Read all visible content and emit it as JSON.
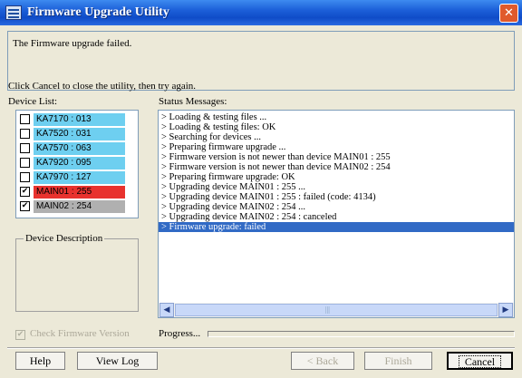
{
  "window": {
    "title": "Firmware Upgrade Utility",
    "close_glyph": "✕"
  },
  "message": {
    "line1": "The Firmware upgrade failed.",
    "line2": "Click Cancel to close the utility, then try again."
  },
  "device_list": {
    "label": "Device List:",
    "items": [
      {
        "name": "KA7170 : 013",
        "checked": false,
        "color": "#6ecff0"
      },
      {
        "name": "KA7520 : 031",
        "checked": false,
        "color": "#6ecff0"
      },
      {
        "name": "KA7570 : 063",
        "checked": false,
        "color": "#6ecff0"
      },
      {
        "name": "KA7920 : 095",
        "checked": false,
        "color": "#6ecff0"
      },
      {
        "name": "KA7970 : 127",
        "checked": false,
        "color": "#6ecff0"
      },
      {
        "name": "MAIN01 : 255",
        "checked": true,
        "color": "#e8322e"
      },
      {
        "name": "MAIN02 : 254",
        "checked": true,
        "color": "#b0b0b0"
      }
    ]
  },
  "device_description": {
    "label": "Device Description"
  },
  "status": {
    "label": "Status Messages:",
    "lines": [
      "> Loading & testing files ...",
      "> Loading & testing files: OK",
      "> Searching for devices ...",
      "> Preparing firmware upgrade ...",
      "> Firmware version is not newer than device MAIN01 : 255",
      "> Firmware version is not newer than device MAIN02 : 254",
      "> Preparing firmware upgrade: OK",
      "> Upgrading device MAIN01 : 255 ...",
      "> Upgrading device MAIN01 : 255 : failed (code: 4134)",
      "> Upgrading device MAIN02 : 254 ...",
      "> Upgrading device MAIN02 : 254 : canceled",
      "> Firmware upgrade: failed"
    ],
    "selected_index": 11,
    "scroll_left_icon": "◀",
    "scroll_right_icon": "▶",
    "scroll_grip": "|||"
  },
  "options": {
    "check_firmware_label": "Check Firmware Version",
    "check_firmware_checked": true
  },
  "progress": {
    "label": "Progress...",
    "value": 0
  },
  "buttons": {
    "help": "Help",
    "view_log": "View Log",
    "back": "< Back",
    "finish": "Finish",
    "cancel": "Cancel"
  },
  "icons": {
    "checkmark": "✔"
  }
}
